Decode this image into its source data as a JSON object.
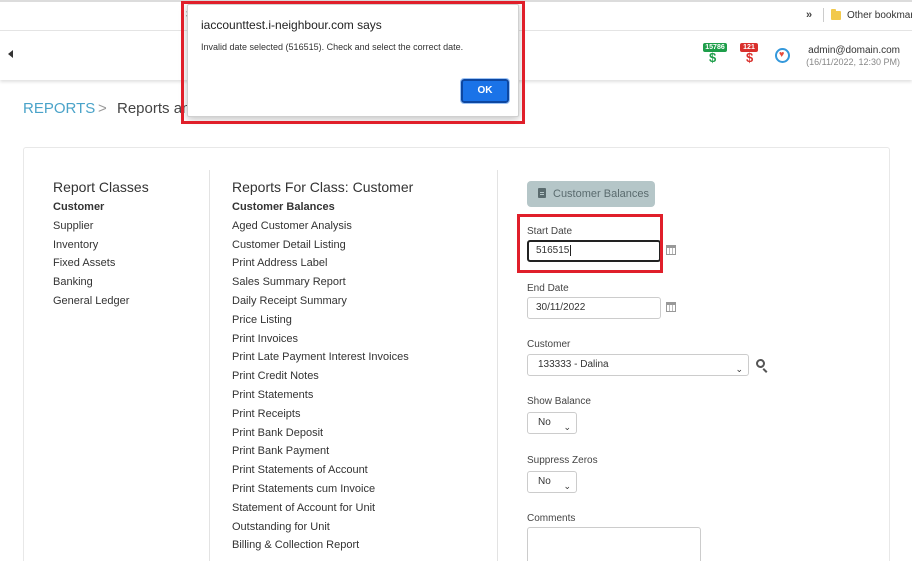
{
  "browser": {
    "overflow_chevron": "»",
    "bookmark_folder": "Other bookmark"
  },
  "header": {
    "badge_green_count": "15786",
    "badge_red_count": "121",
    "badge_symbol": "$",
    "user_email": "admin@domain.com",
    "user_datetime": "(16/11/2022, 12:30 PM)"
  },
  "breadcrumb": {
    "root": "REPORTS",
    "separator": ">",
    "current": "Reports and"
  },
  "report_classes": {
    "title": "Report Classes",
    "items": [
      {
        "label": "Customer",
        "active": true
      },
      {
        "label": "Supplier"
      },
      {
        "label": "Inventory"
      },
      {
        "label": "Fixed Assets"
      },
      {
        "label": "Banking"
      },
      {
        "label": "General Ledger"
      }
    ]
  },
  "reports_for_class": {
    "title": "Reports For Class:  Customer",
    "items": [
      {
        "label": "Customer Balances",
        "active": true
      },
      {
        "label": "Aged Customer Analysis"
      },
      {
        "label": "Customer Detail Listing"
      },
      {
        "label": "Print Address Label"
      },
      {
        "label": "Sales Summary Report"
      },
      {
        "label": "Daily Receipt Summary"
      },
      {
        "label": "Price Listing"
      },
      {
        "label": "Print Invoices"
      },
      {
        "label": "Print Late Payment Interest Invoices"
      },
      {
        "label": "Print Credit Notes"
      },
      {
        "label": "Print Statements"
      },
      {
        "label": "Print Receipts"
      },
      {
        "label": "Print Bank Deposit"
      },
      {
        "label": "Print Bank Payment"
      },
      {
        "label": "Print Statements of Account"
      },
      {
        "label": "Print Statements cum Invoice"
      },
      {
        "label": "Statement of Account for Unit"
      },
      {
        "label": "Outstanding for Unit"
      },
      {
        "label": "Billing & Collection Report"
      }
    ]
  },
  "form": {
    "report_button": "Customer Balances",
    "start_date_label": "Start Date",
    "start_date_value": "516515",
    "end_date_label": "End Date",
    "end_date_value": "30/11/2022",
    "customer_label": "Customer",
    "customer_value": "133333 - Dalina",
    "show_balance_label": "Show Balance",
    "show_balance_value": "No",
    "suppress_zeros_label": "Suppress Zeros",
    "suppress_zeros_value": "No",
    "comments_label": "Comments"
  },
  "dialog": {
    "peek": "3",
    "title": "iaccounttest.i-neighbour.com says",
    "message": "Invalid date selected (516515). Check and select the correct date.",
    "ok_label": "OK"
  },
  "colors": {
    "accent": "#4aa3c9",
    "highlight": "#e01f2a",
    "ok_button": "#1a73e8",
    "badge_green": "#1e9e4a",
    "badge_red": "#d9302c"
  }
}
